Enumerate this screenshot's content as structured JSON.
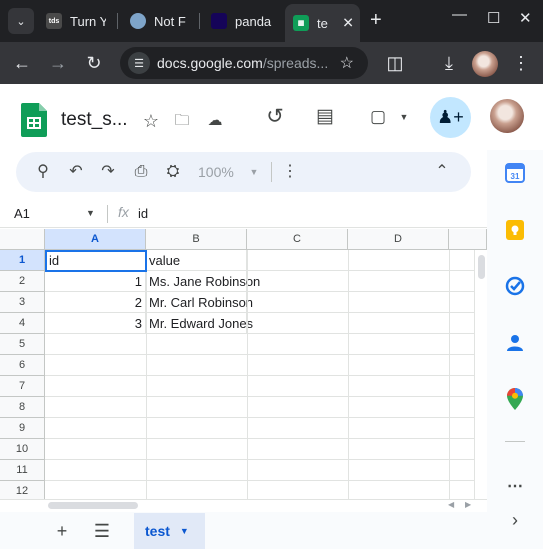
{
  "browser": {
    "tabs": [
      {
        "label": "Turn Y",
        "icon_text": "tds",
        "icon_bg": "#4a4a4a"
      },
      {
        "label": "Not F",
        "icon_text": "",
        "icon_bg": "#7ea4c9"
      },
      {
        "label": "panda",
        "icon_text": "",
        "icon_bg": "#150458"
      },
      {
        "label": "te",
        "icon_text": "",
        "icon_bg": "#0f9d58"
      }
    ],
    "url_host": "docs.google.com",
    "url_rest": "/spreads..."
  },
  "app": {
    "doc_title": "test_s...",
    "zoom": "100%",
    "accent": "#0b57d0"
  },
  "formula_bar": {
    "cell_ref": "A1",
    "fx_label": "fx",
    "value": "id"
  },
  "sheet": {
    "columns": [
      "A",
      "B",
      "C",
      "D"
    ],
    "row_numbers": [
      "1",
      "2",
      "3",
      "4",
      "5",
      "6",
      "7",
      "8",
      "9",
      "10",
      "11",
      "12"
    ],
    "rows": [
      {
        "a": "id",
        "b": "value"
      },
      {
        "a": "1",
        "b": "Ms. Jane Robinson"
      },
      {
        "a": "2",
        "b": "Mr. Carl Robinson"
      },
      {
        "a": "3",
        "b": "Mr. Edward Jones"
      }
    ],
    "tab_name": "test"
  },
  "side_panel": {
    "calendar_day": "31"
  }
}
